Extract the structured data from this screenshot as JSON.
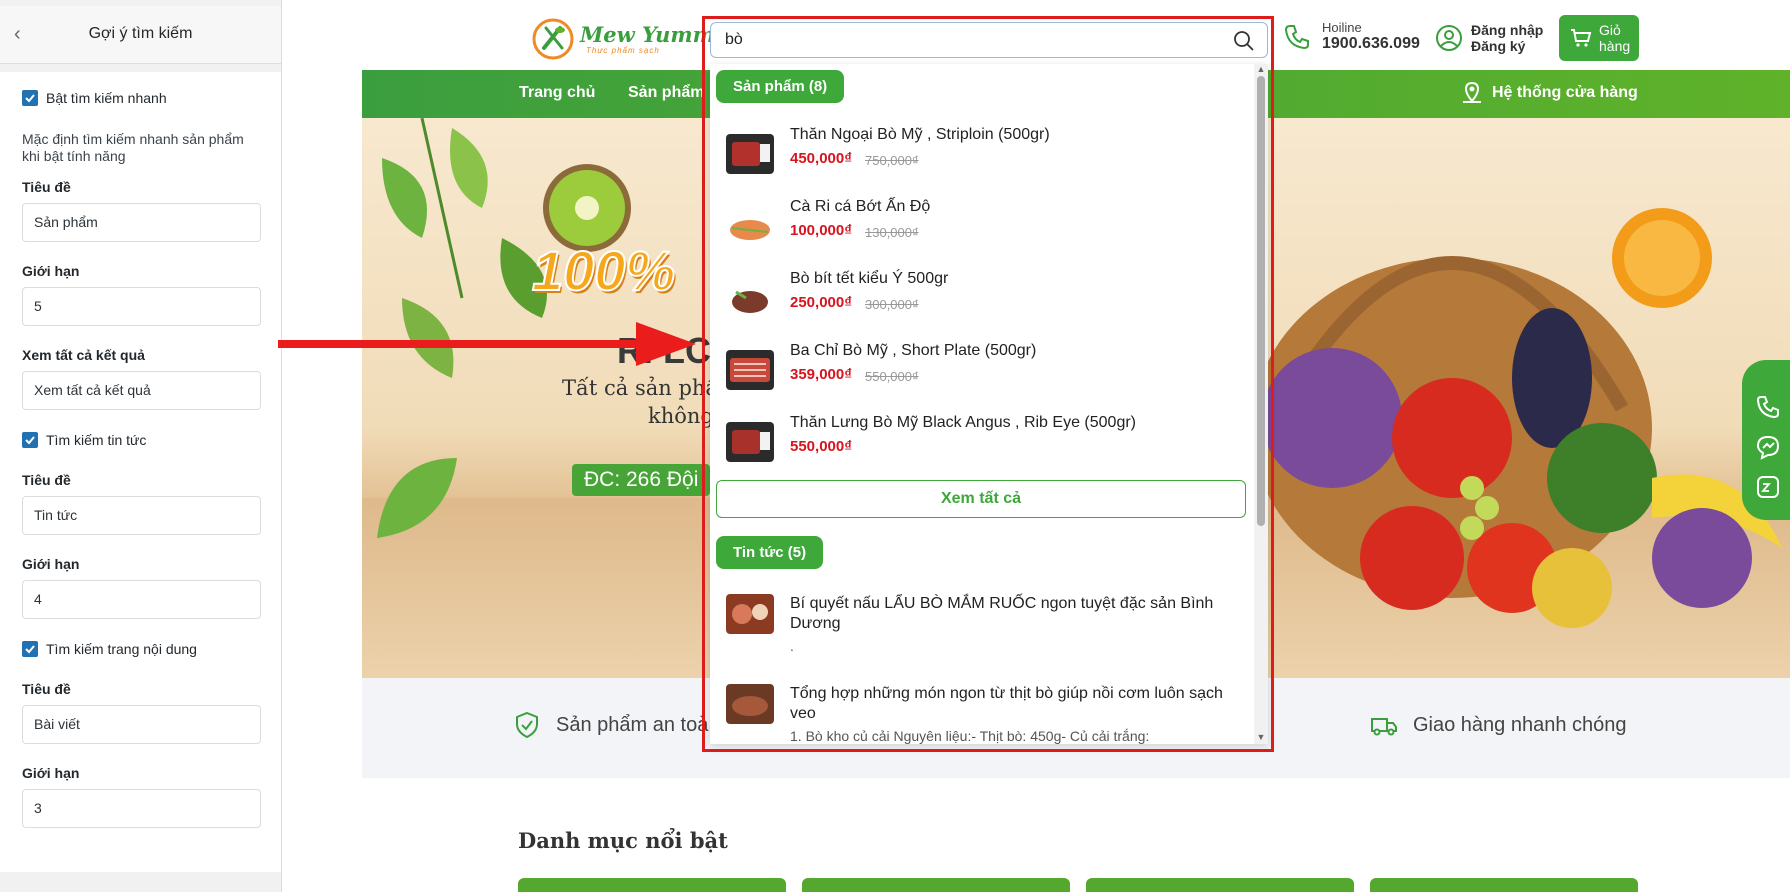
{
  "settings_panel": {
    "title": "Gợi ý tìm kiếm",
    "enable_quick_search": "Bật tìm kiếm nhanh",
    "enable_quick_search_checked": true,
    "description": "Mặc định tìm kiếm nhanh sản phẩm khi bật tính năng",
    "products": {
      "title_label": "Tiêu đề",
      "title_value": "Sản phẩm",
      "limit_label": "Giới hạn",
      "limit_value": "5"
    },
    "view_all": {
      "label": "Xem tất cả kết quả",
      "value": "Xem tất cả kết quả"
    },
    "news": {
      "check_label": "Tìm kiếm tin tức",
      "checked": true,
      "title_label": "Tiêu đề",
      "title_value": "Tin tức",
      "limit_label": "Giới hạn",
      "limit_value": "4"
    },
    "pages": {
      "check_label": "Tìm kiếm trang nội dung",
      "checked": true,
      "title_label": "Tiêu đề",
      "title_value": "Bài viết",
      "limit_label": "Giới hạn",
      "limit_value": "3"
    }
  },
  "header": {
    "logo_text": "Mew Yummy",
    "logo_tagline": "Thực phẩm sạch",
    "hotline_label": "Hoiline",
    "hotline_number": "1900.636.099",
    "login": "Đăng nhập",
    "register": "Đăng ký",
    "cart": "Giỏ hàng"
  },
  "search": {
    "query": "bò",
    "products_badge": "Sản phẩm (8)",
    "products": [
      {
        "name": "Thăn Ngoại Bò Mỹ , Striploin (500gr)",
        "price": "450,000₫",
        "old_price": "750,000₫"
      },
      {
        "name": "Cà Ri cá Bớt Ấn Độ",
        "price": "100,000₫",
        "old_price": "130,000₫"
      },
      {
        "name": "Bò bít tết kiểu Ý 500gr",
        "price": "250,000₫",
        "old_price": "300,000₫"
      },
      {
        "name": "Ba Chỉ Bò Mỹ , Short Plate (500gr)",
        "price": "359,000₫",
        "old_price": "550,000₫"
      },
      {
        "name": "Thăn Lưng Bò Mỹ Black Angus , Rib Eye (500gr)",
        "price": "550,000₫",
        "old_price": ""
      }
    ],
    "view_all": "Xem tất cả",
    "news_badge": "Tin tức (5)",
    "news": [
      {
        "title": "Bí quyết nấu LẨU BÒ MẮM RUỐC ngon tuyệt đặc sản Bình Dương",
        "excerpt": "."
      },
      {
        "title": "Tổng hợp những món ngon từ thịt bò giúp nồi cơm luôn sạch veo",
        "excerpt": "1. Bò kho củ cải Nguyên liệu:- Thịt bò: 450g- Củ cải trắng:"
      }
    ]
  },
  "nav": {
    "home": "Trang chủ",
    "products": "Sản phẩm",
    "stores": "Hệ thống cửa hàng"
  },
  "banner": {
    "hundred": "100%",
    "title": "R. LC",
    "line1": "Tất cả sản phẩm",
    "line2": "không",
    "address": "ĐC: 266 Đội"
  },
  "features": {
    "safe": "Sản phẩm an toà",
    "delivery": "Giao hàng nhanh chóng"
  },
  "section_title": "Danh mục nổi bật",
  "colors": {
    "brand_green": "#3ea83a",
    "price_red": "#d7141e",
    "annotation_red": "#dd1c1c",
    "checkbox_blue": "#2271b1"
  }
}
